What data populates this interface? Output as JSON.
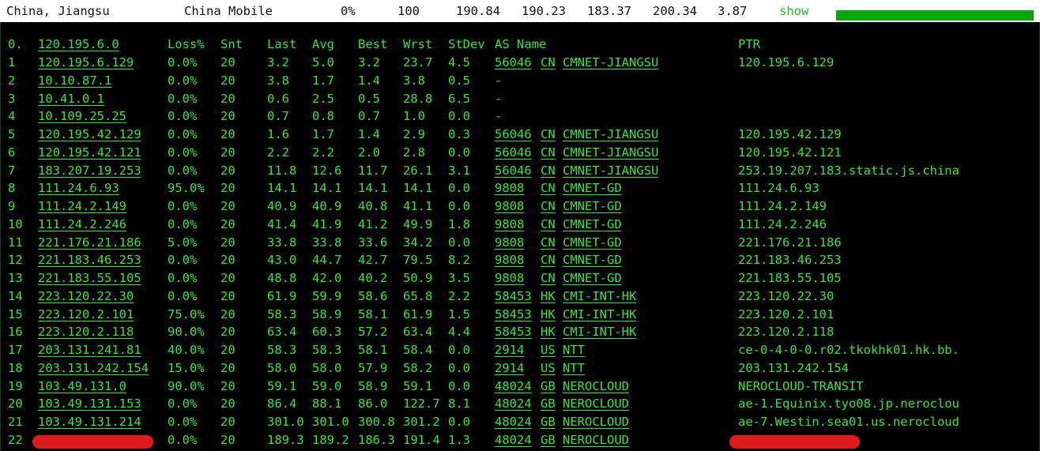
{
  "summary": {
    "location": "China, Jiangsu",
    "isp": "China Mobile",
    "loss": "0%",
    "sent": "100",
    "last": "190.84",
    "avg": "190.23",
    "best": "183.37",
    "worst": "200.34",
    "stdev": "3.87",
    "show_label": "show",
    "progress": 1.0
  },
  "headers": {
    "hop": "0.",
    "host": "120.195.6.0",
    "loss": "Loss%",
    "snt": "Snt",
    "last": "Last",
    "avg": "Avg",
    "best": "Best",
    "wrst": "Wrst",
    "stdev": "StDev",
    "as_name": "AS Name",
    "ptr": "PTR"
  },
  "colors": {
    "text": "#3ee23e",
    "background": "#000000",
    "topbar": "#ffffff",
    "redaction": "#e01b1b",
    "progress": "#0aa60a"
  },
  "hops": [
    {
      "hop": "1",
      "host": "120.195.6.129",
      "loss": "0.0%",
      "snt": "20",
      "last": "3.2",
      "avg": "5.0",
      "best": "3.2",
      "wrst": "23.7",
      "stdev": "4.5",
      "asn": "56046",
      "cc": "CN",
      "asname": "CMNET-JIANGSU",
      "ptr": "120.195.6.129"
    },
    {
      "hop": "2",
      "host": "10.10.87.1",
      "loss": "0.0%",
      "snt": "20",
      "last": "3.8",
      "avg": "1.7",
      "best": "1.4",
      "wrst": "3.8",
      "stdev": "0.5",
      "asn": "-",
      "cc": "",
      "asname": "",
      "ptr": ""
    },
    {
      "hop": "3",
      "host": "10.41.0.1",
      "loss": "0.0%",
      "snt": "20",
      "last": "0.6",
      "avg": "2.5",
      "best": "0.5",
      "wrst": "28.8",
      "stdev": "6.5",
      "asn": "-",
      "cc": "",
      "asname": "",
      "ptr": ""
    },
    {
      "hop": "4",
      "host": "10.109.25.25",
      "loss": "0.0%",
      "snt": "20",
      "last": "0.7",
      "avg": "0.8",
      "best": "0.7",
      "wrst": "1.0",
      "stdev": "0.0",
      "asn": "-",
      "cc": "",
      "asname": "",
      "ptr": ""
    },
    {
      "hop": "5",
      "host": "120.195.42.129",
      "loss": "0.0%",
      "snt": "20",
      "last": "1.6",
      "avg": "1.7",
      "best": "1.4",
      "wrst": "2.9",
      "stdev": "0.3",
      "asn": "56046",
      "cc": "CN",
      "asname": "CMNET-JIANGSU",
      "ptr": "120.195.42.129"
    },
    {
      "hop": "6",
      "host": "120.195.42.121",
      "loss": "0.0%",
      "snt": "20",
      "last": "2.2",
      "avg": "2.2",
      "best": "2.0",
      "wrst": "2.8",
      "stdev": "0.0",
      "asn": "56046",
      "cc": "CN",
      "asname": "CMNET-JIANGSU",
      "ptr": "120.195.42.121"
    },
    {
      "hop": "7",
      "host": "183.207.19.253",
      "loss": "0.0%",
      "snt": "20",
      "last": "11.8",
      "avg": "12.6",
      "best": "11.7",
      "wrst": "26.1",
      "stdev": "3.1",
      "asn": "56046",
      "cc": "CN",
      "asname": "CMNET-JIANGSU",
      "ptr": "253.19.207.183.static.js.china"
    },
    {
      "hop": "8",
      "host": "111.24.6.93",
      "loss": "95.0%",
      "snt": "20",
      "last": "14.1",
      "avg": "14.1",
      "best": "14.1",
      "wrst": "14.1",
      "stdev": "0.0",
      "asn": "9808",
      "cc": "CN",
      "asname": "CMNET-GD",
      "ptr": "111.24.6.93"
    },
    {
      "hop": "9",
      "host": "111.24.2.149",
      "loss": "0.0%",
      "snt": "20",
      "last": "40.9",
      "avg": "40.9",
      "best": "40.8",
      "wrst": "41.1",
      "stdev": "0.0",
      "asn": "9808",
      "cc": "CN",
      "asname": "CMNET-GD",
      "ptr": "111.24.2.149"
    },
    {
      "hop": "10",
      "host": "111.24.2.246",
      "loss": "0.0%",
      "snt": "20",
      "last": "41.4",
      "avg": "41.9",
      "best": "41.2",
      "wrst": "49.9",
      "stdev": "1.8",
      "asn": "9808",
      "cc": "CN",
      "asname": "CMNET-GD",
      "ptr": "111.24.2.246"
    },
    {
      "hop": "11",
      "host": "221.176.21.186",
      "loss": "5.0%",
      "snt": "20",
      "last": "33.8",
      "avg": "33.8",
      "best": "33.6",
      "wrst": "34.2",
      "stdev": "0.0",
      "asn": "9808",
      "cc": "CN",
      "asname": "CMNET-GD",
      "ptr": "221.176.21.186"
    },
    {
      "hop": "12",
      "host": "221.183.46.253",
      "loss": "0.0%",
      "snt": "20",
      "last": "43.0",
      "avg": "44.7",
      "best": "42.7",
      "wrst": "79.5",
      "stdev": "8.2",
      "asn": "9808",
      "cc": "CN",
      "asname": "CMNET-GD",
      "ptr": "221.183.46.253"
    },
    {
      "hop": "13",
      "host": "221.183.55.105",
      "loss": "0.0%",
      "snt": "20",
      "last": "48.8",
      "avg": "42.0",
      "best": "40.2",
      "wrst": "50.9",
      "stdev": "3.5",
      "asn": "9808",
      "cc": "CN",
      "asname": "CMNET-GD",
      "ptr": "221.183.55.105"
    },
    {
      "hop": "14",
      "host": "223.120.22.30",
      "loss": "0.0%",
      "snt": "20",
      "last": "61.9",
      "avg": "59.9",
      "best": "58.6",
      "wrst": "65.8",
      "stdev": "2.2",
      "asn": "58453",
      "cc": "HK",
      "asname": "CMI-INT-HK",
      "ptr": "223.120.22.30"
    },
    {
      "hop": "15",
      "host": "223.120.2.101",
      "loss": "75.0%",
      "snt": "20",
      "last": "58.3",
      "avg": "58.9",
      "best": "58.1",
      "wrst": "61.9",
      "stdev": "1.5",
      "asn": "58453",
      "cc": "HK",
      "asname": "CMI-INT-HK",
      "ptr": "223.120.2.101"
    },
    {
      "hop": "16",
      "host": "223.120.2.118",
      "loss": "90.0%",
      "snt": "20",
      "last": "63.4",
      "avg": "60.3",
      "best": "57.2",
      "wrst": "63.4",
      "stdev": "4.4",
      "asn": "58453",
      "cc": "HK",
      "asname": "CMI-INT-HK",
      "ptr": "223.120.2.118"
    },
    {
      "hop": "17",
      "host": "203.131.241.81",
      "loss": "40.0%",
      "snt": "20",
      "last": "58.3",
      "avg": "58.3",
      "best": "58.1",
      "wrst": "58.4",
      "stdev": "0.0",
      "asn": "2914",
      "cc": "US",
      "asname": "NTT",
      "ptr": "ce-0-4-0-0.r02.tkokhk01.hk.bb."
    },
    {
      "hop": "18",
      "host": "203.131.242.154",
      "loss": "15.0%",
      "snt": "20",
      "last": "58.0",
      "avg": "58.0",
      "best": "57.9",
      "wrst": "58.2",
      "stdev": "0.0",
      "asn": "2914",
      "cc": "US",
      "asname": "NTT",
      "ptr": "203.131.242.154"
    },
    {
      "hop": "19",
      "host": "103.49.131.0",
      "loss": "90.0%",
      "snt": "20",
      "last": "59.1",
      "avg": "59.0",
      "best": "58.9",
      "wrst": "59.1",
      "stdev": "0.0",
      "asn": "48024",
      "cc": "GB",
      "asname": "NEROCLOUD",
      "ptr": "NEROCLOUD-TRANSIT"
    },
    {
      "hop": "20",
      "host": "103.49.131.153",
      "loss": "0.0%",
      "snt": "20",
      "last": "86.4",
      "avg": "88.1",
      "best": "86.0",
      "wrst": "122.7",
      "stdev": "8.1",
      "asn": "48024",
      "cc": "GB",
      "asname": "NEROCLOUD",
      "ptr": "ae-1.Equinix.tyo08.jp.neroclou"
    },
    {
      "hop": "21",
      "host": "103.49.131.214",
      "loss": "0.0%",
      "snt": "20",
      "last": "301.0",
      "avg": "301.0",
      "best": "300.8",
      "wrst": "301.2",
      "stdev": "0.0",
      "asn": "48024",
      "cc": "GB",
      "asname": "NEROCLOUD",
      "ptr": "ae-7.Westin.sea01.us.nerocloud"
    },
    {
      "hop": "22",
      "host": "",
      "loss": "0.0%",
      "snt": "20",
      "last": "189.3",
      "avg": "189.2",
      "best": "186.3",
      "wrst": "191.4",
      "stdev": "1.3",
      "asn": "48024",
      "cc": "GB",
      "asname": "NEROCLOUD",
      "ptr": "",
      "redacted": true
    }
  ]
}
